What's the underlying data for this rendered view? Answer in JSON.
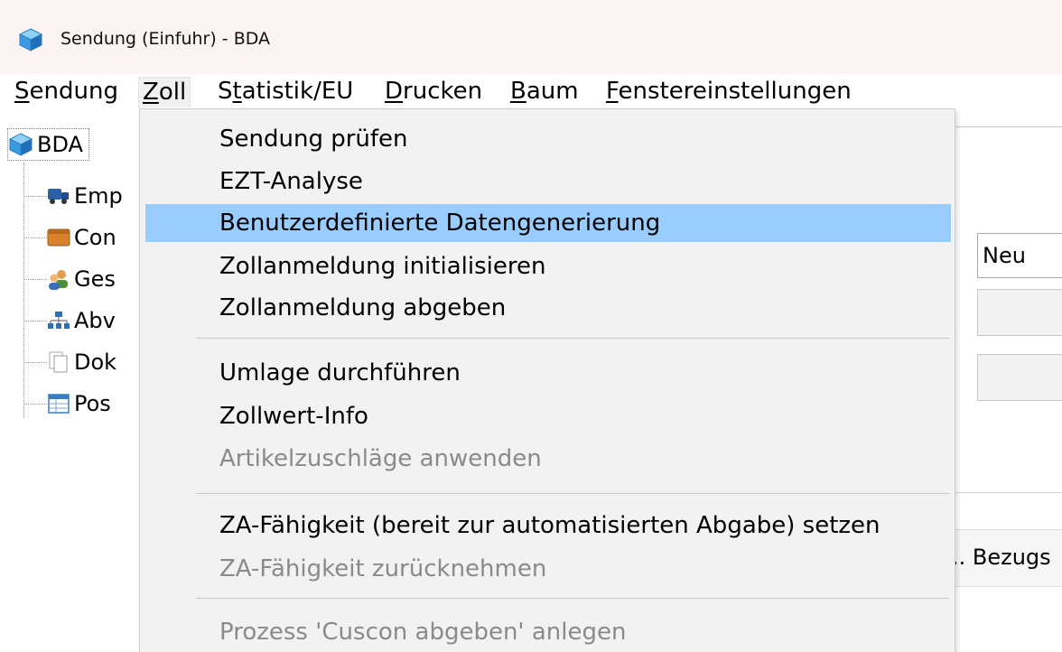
{
  "window": {
    "title": "Sendung (Einfuhr) - BDA",
    "icon": "cube-icon"
  },
  "menubar": {
    "items": [
      {
        "label": "Sendung",
        "accel": "S",
        "rest": "endung"
      },
      {
        "label": "Zoll",
        "accel": "Z",
        "rest": "oll"
      },
      {
        "label": "Statistik/EU",
        "pre": "S",
        "accel": "t",
        "rest": "atistik/EU"
      },
      {
        "label": "Drucken",
        "accel": "D",
        "rest": "rucken"
      },
      {
        "label": "Baum",
        "accel": "B",
        "rest": "aum"
      },
      {
        "label": "Fenstereinstellungen",
        "accel": "F",
        "rest": "enstereinstellungen"
      }
    ]
  },
  "tree": {
    "root": "BDA",
    "nodes": [
      {
        "label": "Emp",
        "icon": "truck-icon"
      },
      {
        "label": "Con",
        "icon": "container-icon"
      },
      {
        "label": "Ges",
        "icon": "people-icon"
      },
      {
        "label": "Abv",
        "icon": "hierarchy-icon"
      },
      {
        "label": "Dok",
        "icon": "documents-icon"
      },
      {
        "label": "Pos",
        "icon": "table-icon"
      }
    ]
  },
  "form": {
    "status_value": "Neu",
    "grid_header": ".. Bezugs"
  },
  "dropdown": {
    "items": [
      {
        "label": "Sendung prüfen",
        "enabled": true
      },
      {
        "label": "EZT-Analyse",
        "enabled": true
      },
      {
        "label": "Benutzerdefinierte Datengenerierung",
        "enabled": true,
        "highlighted": true
      },
      {
        "label": "Zollanmeldung initialisieren",
        "enabled": true
      },
      {
        "label": "Zollanmeldung abgeben",
        "enabled": true
      },
      {
        "label": "Umlage durchführen",
        "enabled": true
      },
      {
        "label": "Zollwert-Info",
        "enabled": true
      },
      {
        "label": "Artikelzuschläge anwenden",
        "enabled": false
      },
      {
        "label": "ZA-Fähigkeit (bereit zur automatisierten Abgabe) setzen",
        "enabled": true
      },
      {
        "label": "ZA-Fähigkeit zurücknehmen",
        "enabled": false
      },
      {
        "label": "Prozess 'Cuscon abgeben' anlegen",
        "enabled": false
      }
    ]
  },
  "colors": {
    "titlebar_bg": "#fcf3f3",
    "menu_highlight": "#99ccff",
    "disabled_text": "#8a8a8a"
  }
}
